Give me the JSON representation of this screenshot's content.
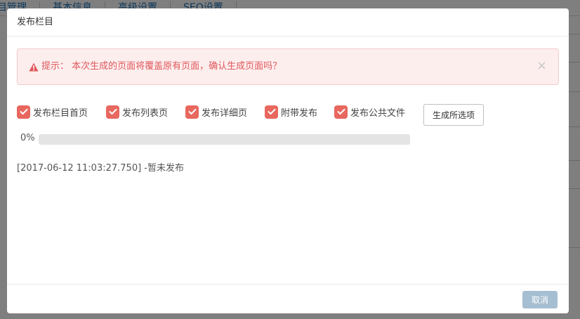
{
  "background": {
    "tabs": [
      "目管理",
      "基本信息",
      "高级设置",
      "SEO设置"
    ]
  },
  "dialog": {
    "title": "发布栏目",
    "alert": {
      "message": "提示： 本次生成的页面将覆盖原有页面，确认生成页面吗？",
      "close": "×"
    },
    "options": [
      {
        "label": "发布栏目首页",
        "checked": true
      },
      {
        "label": "发布列表页",
        "checked": true
      },
      {
        "label": "发布详细页",
        "checked": true
      },
      {
        "label": "附带发布",
        "checked": true
      },
      {
        "label": "发布公共文件",
        "checked": true
      }
    ],
    "generate_button": "生成所选项",
    "progress": {
      "label": "0%",
      "percent": 0
    },
    "log": "[2017-06-12 11:03:27.750] -暂未发布",
    "cancel_button": "取消"
  },
  "colors": {
    "accent": "#e8675e",
    "alert_bg": "#fdeeee",
    "alert_text": "#e0585c",
    "cancel_bg": "#a6bed1",
    "tab_link": "#1a6fb5"
  }
}
